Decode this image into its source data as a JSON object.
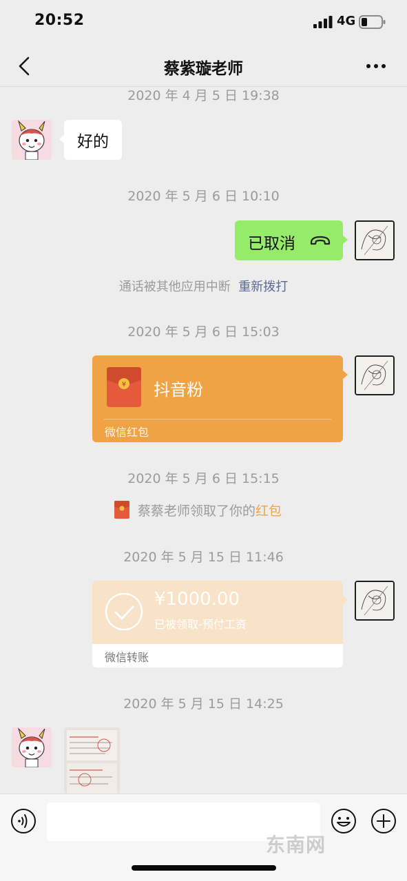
{
  "status_bar": {
    "time": "20:52",
    "network": "4G",
    "icons": [
      "signal-icon",
      "battery-icon"
    ]
  },
  "header": {
    "title": "蔡紫璇老师",
    "icons": [
      "back-icon",
      "more-icon"
    ]
  },
  "messages": {
    "ts1": "2020 年 4 月 5 日 19:38",
    "reply_text": "好的",
    "ts2": "2020 年 5 月 6 日 10:10",
    "call_label": "已取消",
    "call_note": "通话被其他应用中断",
    "redial_label": "重新拨打",
    "ts3": "2020 年 5 月 6 日 15:03",
    "redpacket_title": "抖音粉",
    "redpacket_footer": "微信红包",
    "redpacket_symbol": "¥",
    "ts4": "2020 年 5 月 6 日 15:15",
    "pickup_text": "蔡蔡老师领取了你的",
    "pickup_link": "红包",
    "ts5": "2020 年 5 月 15 日 11:46",
    "transfer_amount": "¥1000.00",
    "transfer_status": "已被领取-预付工资",
    "transfer_footer": "微信转账",
    "ts6": "2020 年 5 月 15 日 14:25"
  },
  "input_bar": {
    "placeholder": "",
    "icons": [
      "voice-icon",
      "emoji-icon",
      "plus-icon"
    ]
  },
  "watermark": "东南网",
  "colors": {
    "background": "#ededed",
    "sent_bubble": "#95ec69",
    "redpacket": "#f0a345",
    "transfer_received": "#f8e2c8",
    "link": "#576b95"
  }
}
